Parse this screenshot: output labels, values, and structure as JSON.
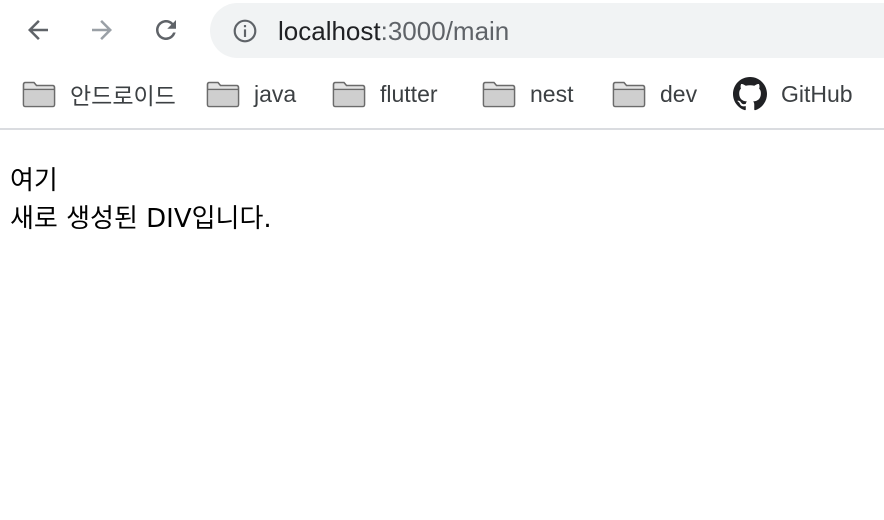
{
  "browser": {
    "url_host": "localhost",
    "url_rest": ":3000/main",
    "icons": {
      "back": "arrow-left-icon",
      "forward": "arrow-right-icon",
      "reload": "reload-icon",
      "site_info": "info-icon"
    }
  },
  "bookmarks": [
    {
      "label": "안드로이드",
      "icon": "folder-icon"
    },
    {
      "label": "java",
      "icon": "folder-icon"
    },
    {
      "label": "flutter",
      "icon": "folder-icon"
    },
    {
      "label": "nest",
      "icon": "folder-icon"
    },
    {
      "label": "dev",
      "icon": "folder-icon"
    },
    {
      "label": "GitHub",
      "icon": "github-icon"
    }
  ],
  "page": {
    "lines": [
      "여기",
      "새로 생성된 DIV입니다."
    ]
  },
  "colors": {
    "omnibox_bg": "#f1f3f4",
    "divider": "#dadce0",
    "forward_disabled": "#9aa0a6"
  }
}
